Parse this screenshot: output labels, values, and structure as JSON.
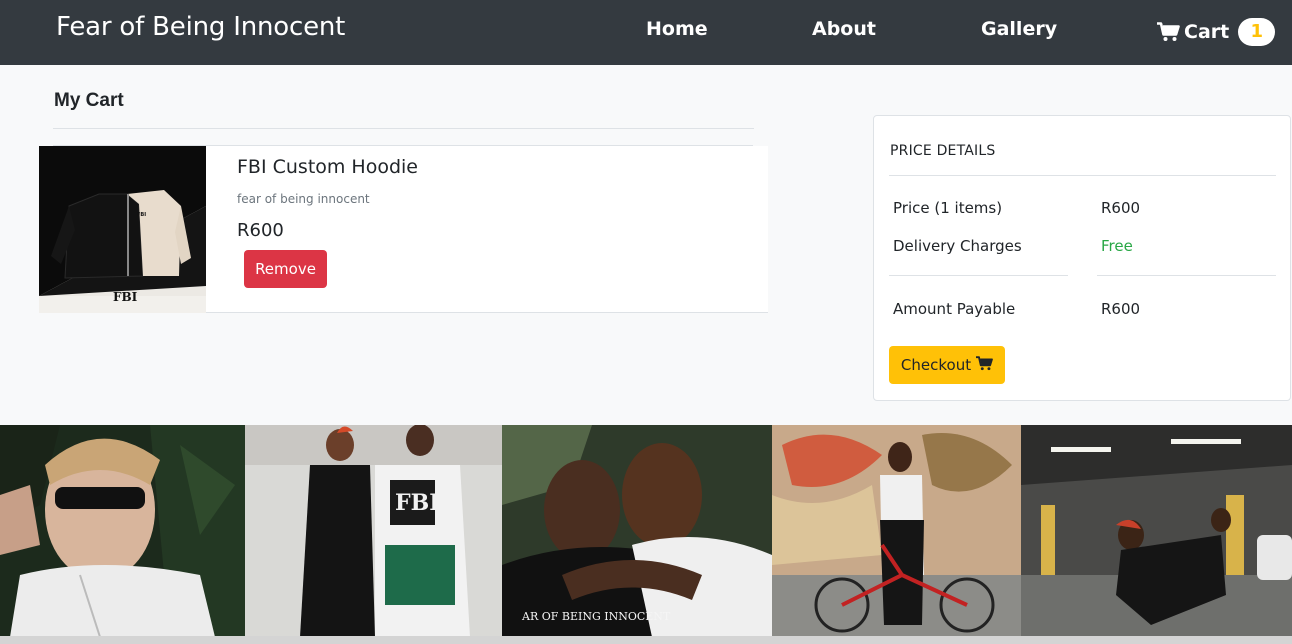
{
  "nav": {
    "brand": "Fear of Being Innocent",
    "links": [
      {
        "label": "Home"
      },
      {
        "label": "About"
      },
      {
        "label": "Gallery"
      }
    ],
    "cart_label": "Cart",
    "cart_count": "1",
    "cart_icon": "shopping-cart-icon"
  },
  "cart": {
    "heading": "My Cart",
    "items": [
      {
        "name": "FBI Custom Hoodie",
        "description": "fear of being innocent",
        "price": "R600",
        "remove_label": "Remove",
        "image_text": "FBI"
      }
    ]
  },
  "price_details": {
    "title": "PRICE DETAILS",
    "price_label": "Price (1 items)",
    "price_value": "R600",
    "delivery_label": "Delivery Charges",
    "delivery_value": "Free",
    "payable_label": "Amount Payable",
    "payable_value": "R600",
    "checkout_label": "Checkout"
  },
  "gallery": {
    "photos": [
      {
        "name": "gallery-photo-sunglasses-man"
      },
      {
        "name": "gallery-photo-couple-skatepark"
      },
      {
        "name": "gallery-photo-two-women-hug",
        "overlay_text": "AR OF BEING INNOCENT"
      },
      {
        "name": "gallery-photo-woman-bicycle-graffiti"
      },
      {
        "name": "gallery-photo-parking-garage"
      }
    ]
  },
  "colors": {
    "navbar": "#343a40",
    "danger": "#dc3545",
    "warning": "#ffc107",
    "success": "#28a745"
  }
}
